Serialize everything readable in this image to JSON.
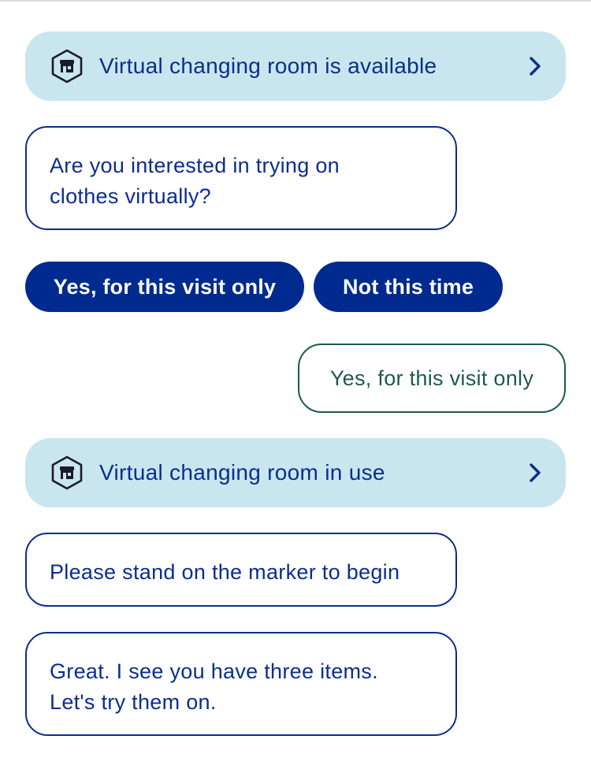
{
  "messages": {
    "status_1": {
      "label": "Virtual changing room is available",
      "icon": "store-icon",
      "action_icon": "chevron-right-icon"
    },
    "bot_1": {
      "line1": "Are you interested in trying on",
      "line2": "clothes virtually?"
    },
    "quick_replies": [
      {
        "label": "Yes, for this visit only"
      },
      {
        "label": "Not this time"
      }
    ],
    "user_1": {
      "text": "Yes, for this visit only"
    },
    "status_2": {
      "label": "Virtual changing room in use",
      "icon": "store-icon",
      "action_icon": "chevron-right-icon"
    },
    "bot_2": {
      "line1": "Please stand on the marker to begin"
    },
    "bot_3": {
      "line1": "Great. I see you have three items.",
      "line2": "Let's try them on."
    }
  },
  "colors": {
    "brand_navy": "#0b2d8f",
    "chip_fill": "#002a8d",
    "status_card_bg": "#c9e6ee",
    "user_bubble_accent": "#1b5a50"
  }
}
